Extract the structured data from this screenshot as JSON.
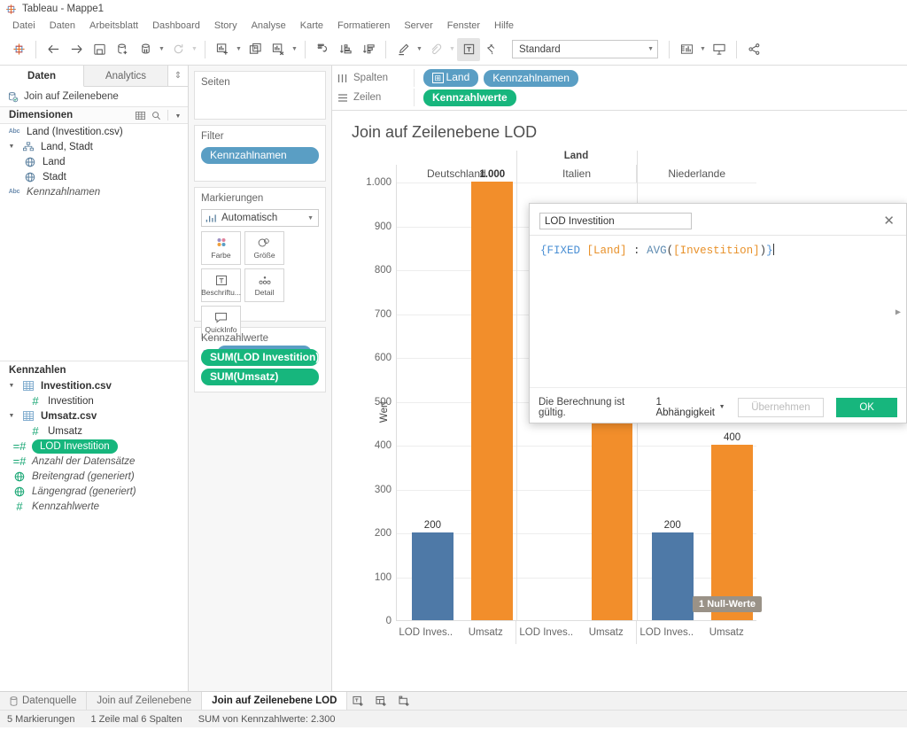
{
  "window": {
    "title": "Tableau - Mappe1",
    "logo_icon": "tableau-logo-icon"
  },
  "menu": {
    "items": [
      "Datei",
      "Daten",
      "Arbeitsblatt",
      "Dashboard",
      "Story",
      "Analyse",
      "Karte",
      "Formatieren",
      "Server",
      "Fenster",
      "Hilfe"
    ]
  },
  "toolbar": {
    "logo_icon": "tableau-logo-icon",
    "back_icon": "arrow-left-icon",
    "forward_icon": "arrow-right-icon",
    "save_icon": "save-icon",
    "new_datasource_icon": "new-data-source-icon",
    "pause_datasource_icon": "pause-updates-icon",
    "refresh_icon": "refresh-icon",
    "new_worksheet_icon": "new-worksheet-icon",
    "duplicate_icon": "duplicate-sheet-icon",
    "clear_icon": "clear-sheet-icon",
    "swap_icon": "swap-rows-columns-icon",
    "sort_asc_icon": "sort-ascending-icon",
    "sort_desc_icon": "sort-descending-icon",
    "highlight_icon": "highlighter-icon",
    "group_icon": "group-members-icon",
    "labels_icon": "show-mark-labels-icon",
    "fixaxis_icon": "fix-axis-icon",
    "fit_value": "Standard",
    "fit_placeholder": "Standard",
    "cards_icon": "show-hide-cards-icon",
    "presentation_icon": "presentation-mode-icon",
    "share_icon": "share-icon"
  },
  "left_pane": {
    "tabs": [
      {
        "label": "Daten",
        "selected": true
      },
      {
        "label": "Analytics",
        "selected": false
      }
    ],
    "tab_overflow_icon": "updown-chevron-icon",
    "datasource": {
      "label": "Join auf Zeilenebene",
      "icon": "data-source-icon"
    },
    "dimensions_section": {
      "title": "Dimensionen",
      "grid_icon": "grid-view-icon",
      "search_icon": "search-icon",
      "menu_icon": "chevron-down-icon",
      "fields": [
        {
          "label": "Land (Investition.csv)",
          "icon": "abc-icon",
          "indent": 0,
          "italic": false
        },
        {
          "label": "Land, Stadt",
          "icon": "hierarchy-icon",
          "indent": 0,
          "italic": false,
          "expander": "chevron-down-icon"
        },
        {
          "label": "Land",
          "icon": "globe-icon",
          "indent": 1,
          "italic": false
        },
        {
          "label": "Stadt",
          "icon": "globe-icon",
          "indent": 1,
          "italic": false
        },
        {
          "label": "Kennzahlnamen",
          "icon": "abc-icon",
          "indent": 0,
          "italic": true
        }
      ]
    },
    "measures_section": {
      "title": "Kennzahlen",
      "fields": [
        {
          "label": "Investition.csv",
          "icon": "table-icon",
          "indent": 0,
          "italic": false,
          "bold": true,
          "expander": "chevron-down-icon"
        },
        {
          "label": "Investition",
          "icon": "number-icon",
          "indent": 1,
          "italic": false
        },
        {
          "label": "Umsatz.csv",
          "icon": "table-icon",
          "indent": 0,
          "italic": false,
          "bold": true,
          "expander": "chevron-down-icon"
        },
        {
          "label": "Umsatz",
          "icon": "number-icon",
          "indent": 1,
          "italic": false
        },
        {
          "label": "LOD Investition",
          "icon": "calculated-number-icon",
          "indent": 0,
          "italic": false,
          "selected": true
        },
        {
          "label": "Anzahl der Datensätze",
          "icon": "calculated-number-icon",
          "indent": 0,
          "italic": true
        },
        {
          "label": "Breitengrad (generiert)",
          "icon": "globe-icon",
          "indent": 0,
          "italic": true
        },
        {
          "label": "Längengrad (generiert)",
          "icon": "globe-icon",
          "indent": 0,
          "italic": true
        },
        {
          "label": "Kennzahlwerte",
          "icon": "number-icon",
          "indent": 0,
          "italic": true
        }
      ]
    }
  },
  "cards": {
    "pages": {
      "title": "Seiten"
    },
    "filter": {
      "title": "Filter",
      "pills": [
        "Kennzahlnamen"
      ]
    },
    "marks": {
      "title": "Markierungen",
      "mark_type": "Automatisch",
      "mark_type_icon": "bar-chart-icon",
      "buttons": [
        {
          "label": "Farbe",
          "icon": "color-icon"
        },
        {
          "label": "Größe",
          "icon": "size-icon"
        },
        {
          "label": "Beschriftu...",
          "icon": "label-icon"
        },
        {
          "label": "Detail",
          "icon": "detail-icon"
        },
        {
          "label": "QuickInfo",
          "icon": "tooltip-icon"
        }
      ],
      "encoding_pills": [
        {
          "label": "Kennzahlnamen",
          "icon": "color-icon"
        }
      ]
    },
    "measure_values": {
      "title": "Kennzahlwerte",
      "pills": [
        "SUM(LOD Investition)",
        "SUM(Umsatz)"
      ]
    }
  },
  "shelves": {
    "columns": {
      "label": "Spalten",
      "icon": "columns-icon",
      "pills": [
        "Land",
        "Kennzahlnamen"
      ],
      "first_pill_expand_icon": "plus-box-icon"
    },
    "rows": {
      "label": "Zeilen",
      "icon": "rows-icon",
      "pills": [
        "Kennzahlwerte"
      ]
    }
  },
  "worksheet": {
    "title": "Join auf Zeilenebene LOD",
    "null_tooltip": "1 Null-Werte"
  },
  "chart_data": {
    "type": "bar",
    "title": "Join auf Zeilenebene LOD",
    "xlabel": "Land",
    "ylabel": "Wert",
    "ylim": [
      0,
      1000
    ],
    "yticks": [
      0,
      100,
      200,
      300,
      400,
      500,
      600,
      700,
      800,
      900,
      1000
    ],
    "ytick_labels": [
      "0",
      "100",
      "200",
      "300",
      "400",
      "500",
      "600",
      "700",
      "800",
      "900",
      "1.000"
    ],
    "grid": true,
    "legend": "none",
    "group_header": "Land",
    "groups": [
      "Deutschland",
      "Italien",
      "Niederlande"
    ],
    "categories": [
      "LOD Inves..",
      "Umsatz"
    ],
    "category_full": [
      "LOD Investition",
      "Umsatz"
    ],
    "colors": {
      "LOD Investition": "#4E79A7",
      "Umsatz": "#F28E2B"
    },
    "bars": [
      {
        "group": "Deutschland",
        "category": "LOD Inves..",
        "value": 200,
        "label": "200",
        "color": "#4E79A7"
      },
      {
        "group": "Deutschland",
        "category": "Umsatz",
        "value": 1000,
        "label": "1.000",
        "color": "#F28E2B",
        "label_bold": true
      },
      {
        "group": "Italien",
        "category": "LOD Inves..",
        "value": null,
        "label": "",
        "color": "#4E79A7"
      },
      {
        "group": "Italien",
        "category": "Umsatz",
        "value": 500,
        "label": "500",
        "color": "#F28E2B"
      },
      {
        "group": "Niederlande",
        "category": "LOD Inves..",
        "value": 200,
        "label": "200",
        "color": "#4E79A7"
      },
      {
        "group": "Niederlande",
        "category": "Umsatz",
        "value": 400,
        "label": "400",
        "color": "#F28E2B"
      }
    ]
  },
  "calc_dialog": {
    "name_value": "LOD Investition",
    "name_placeholder": "Name des Feldes",
    "close_icon": "close-icon",
    "formula_tokens": [
      {
        "text": "{",
        "type": "brace"
      },
      {
        "text": "FIXED ",
        "type": "kw"
      },
      {
        "text": "[Land]",
        "type": "field"
      },
      {
        "text": " : ",
        "type": "plain"
      },
      {
        "text": "AVG",
        "type": "fn"
      },
      {
        "text": "(",
        "type": "plain"
      },
      {
        "text": "[Investition]",
        "type": "field"
      },
      {
        "text": ")",
        "type": "plain"
      },
      {
        "text": "}",
        "type": "brace"
      }
    ],
    "formula_text": "{FIXED [Land] : AVG([Investition])}",
    "validity": "Die Berechnung ist gültig.",
    "dependency": "1 Abhängigkeit",
    "dependency_caret_icon": "chevron-down-icon",
    "apply_label": "Übernehmen",
    "ok_label": "OK",
    "expand_icon": "chevron-right-icon"
  },
  "sheet_tabs": {
    "datasource": {
      "label": "Datenquelle",
      "icon": "database-icon"
    },
    "tabs": [
      {
        "label": "Join auf Zeilenebene",
        "selected": false
      },
      {
        "label": "Join auf Zeilenebene LOD",
        "selected": true
      }
    ],
    "new_worksheet_icon": "new-worksheet-icon",
    "new_dashboard_icon": "new-dashboard-icon",
    "new_story_icon": "new-story-icon"
  },
  "status_bar": {
    "marks": "5 Markierungen",
    "dimensions": "1 Zeile mal 6 Spalten",
    "aggregate": "SUM von Kennzahlwerte: 2.300"
  }
}
